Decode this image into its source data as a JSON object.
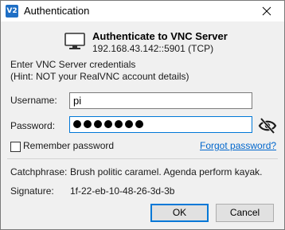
{
  "window": {
    "title": "Authentication",
    "app_icon_text": "V2"
  },
  "header": {
    "heading": "Authenticate to VNC Server",
    "server_address": "192.168.43.142::5901 (TCP)"
  },
  "prompt": {
    "line1": "Enter VNC Server credentials",
    "line2": "(Hint: NOT your RealVNC account details)"
  },
  "form": {
    "username_label": "Username:",
    "username_value": "pi",
    "password_label": "Password:",
    "password_length": 7,
    "remember_label": "Remember password",
    "remember_checked": false,
    "forgot_link": "Forgot password?"
  },
  "identity": {
    "catchphrase_label": "Catchphrase:",
    "catchphrase_value": "Brush politic caramel. Agenda perform kayak.",
    "signature_label": "Signature:",
    "signature_value": "1f-22-eb-10-48-26-3d-3b"
  },
  "buttons": {
    "ok": "OK",
    "cancel": "Cancel"
  },
  "colors": {
    "accent": "#0078d7",
    "link": "#0066cc",
    "app_icon": "#1f6fc5"
  },
  "icons": {
    "app": "vnc-viewer-icon",
    "close": "close-icon",
    "monitor": "monitor-icon",
    "reveal": "eye-slash-icon"
  }
}
